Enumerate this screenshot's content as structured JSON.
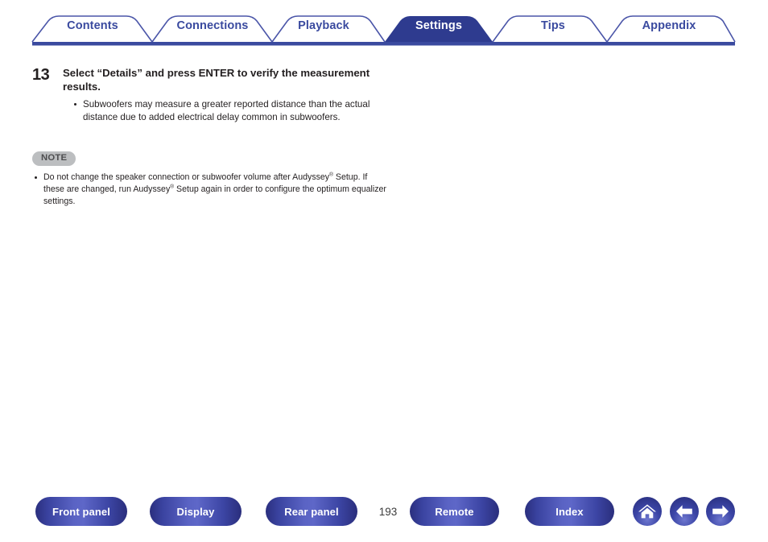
{
  "colors": {
    "tab_blue": "#3a4a9f",
    "tab_active_fill": "#2e3b8f",
    "note_badge_bg": "#bcbec0",
    "text": "#231f20",
    "button_blue": "#3b45a6"
  },
  "tabs": [
    {
      "label": "Contents",
      "active": false
    },
    {
      "label": "Connections",
      "active": false
    },
    {
      "label": "Playback",
      "active": false
    },
    {
      "label": "Settings",
      "active": true
    },
    {
      "label": "Tips",
      "active": false
    },
    {
      "label": "Appendix",
      "active": false
    }
  ],
  "step": {
    "number": "13",
    "title": "Select “Details” and press ENTER to verify the measurement results.",
    "bullets": [
      "Subwoofers may measure a greater reported distance than the actual distance due to added electrical delay common in subwoofers."
    ]
  },
  "note": {
    "badge": "NOTE",
    "bullets_html": [
      "Do not change the speaker connection or subwoofer volume after Audyssey<sup>®</sup> Setup. If these are changed, run Audyssey<sup>®</sup> Setup again in order to configure the optimum equalizer settings."
    ]
  },
  "footer": {
    "buttons": [
      {
        "label": "Front panel"
      },
      {
        "label": "Display"
      },
      {
        "label": "Rear panel"
      },
      {
        "label": "Remote"
      },
      {
        "label": "Index"
      }
    ],
    "page_number": "193",
    "icons": [
      {
        "name": "home-icon"
      },
      {
        "name": "arrow-left-icon"
      },
      {
        "name": "arrow-right-icon"
      }
    ]
  }
}
